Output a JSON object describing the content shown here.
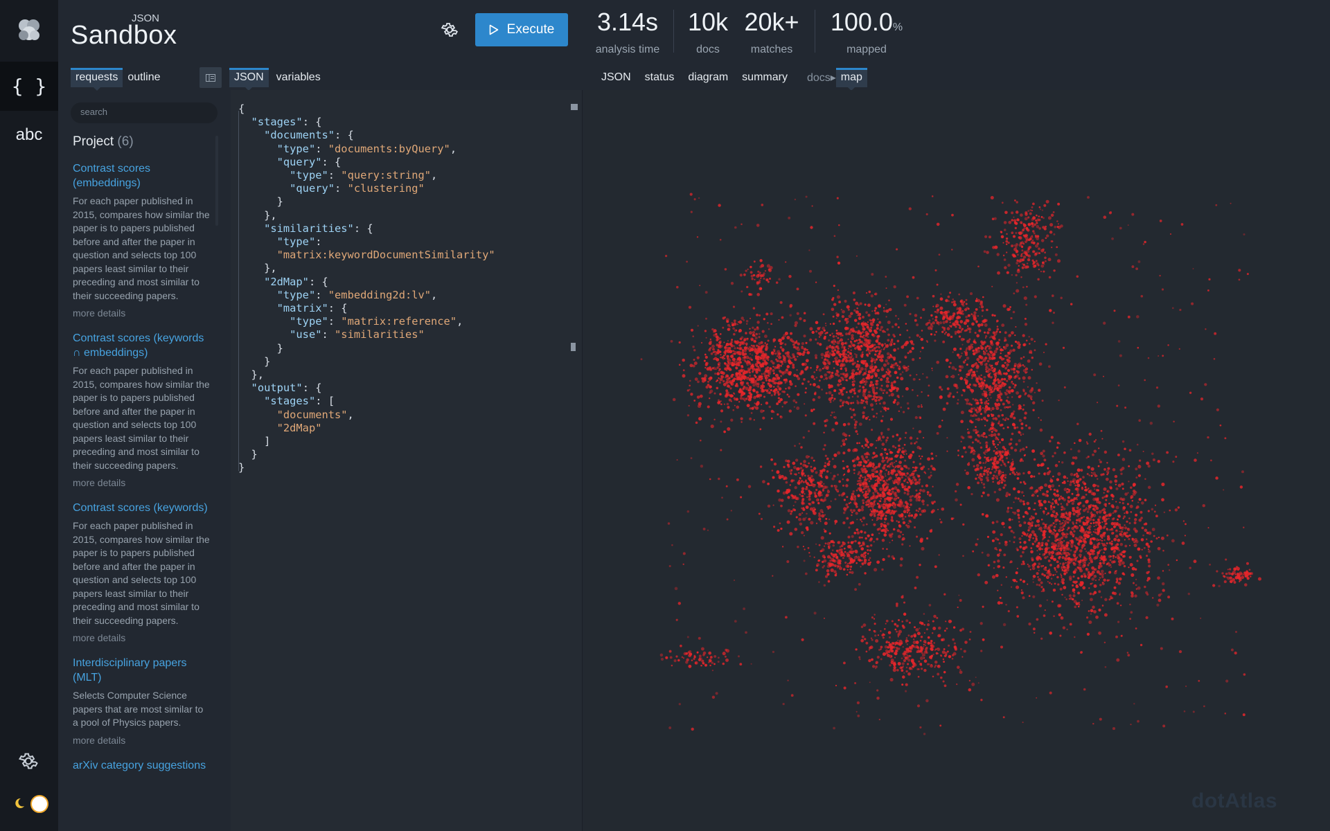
{
  "brand": {
    "sub": "JSON",
    "title": "Sandbox"
  },
  "toolbar": {
    "execute_label": "Execute"
  },
  "stats": [
    {
      "value": "3.14s",
      "unit": "",
      "label": "analysis time"
    },
    {
      "value": "10k",
      "unit": "",
      "label": "docs"
    },
    {
      "value": "20k+",
      "unit": "",
      "label": "matches"
    },
    {
      "value": "100.0",
      "unit": "%",
      "label": "mapped"
    }
  ],
  "rail": {
    "json_label": "{ }",
    "abc_label": "abc"
  },
  "left_tabs": [
    "requests",
    "outline"
  ],
  "editor_tabs": [
    "JSON",
    "variables"
  ],
  "result_tabs": [
    "JSON",
    "status",
    "diagram",
    "summary"
  ],
  "result_crumb": {
    "parent": "docs",
    "active": "map"
  },
  "search": {
    "placeholder": "search"
  },
  "project": {
    "title": "Project",
    "count": "(6)"
  },
  "requests": [
    {
      "title": "Contrast scores (embeddings)",
      "desc": "For each paper published in 2015, compares how similar the paper is to papers published before and after the paper in question and selects top 100 papers least similar to their preceding and most similar to their succeeding papers.",
      "more": "more details"
    },
    {
      "title": "Contrast scores (keywords ∩ embeddings)",
      "desc": "For each paper published in 2015, compares how similar the paper is to papers published before and after the paper in question and selects top 100 papers least similar to their preceding and most similar to their succeeding papers.",
      "more": "more details"
    },
    {
      "title": "Contrast scores (keywords)",
      "desc": "For each paper published in 2015, compares how similar the paper is to papers published before and after the paper in question and selects top 100 papers least similar to their preceding and most similar to their succeeding papers.",
      "more": "more details"
    },
    {
      "title": "Interdisciplinary papers (MLT)",
      "desc": "Selects Computer Science papers that are most similar to a pool of Physics papers.",
      "more": "more details"
    },
    {
      "title": "arXiv category suggestions",
      "desc": "",
      "more": ""
    }
  ],
  "code": [
    [
      [
        "p",
        "{"
      ]
    ],
    [
      [
        "p",
        "  "
      ],
      [
        "k",
        "\"stages\""
      ],
      [
        "p",
        ": {"
      ]
    ],
    [
      [
        "p",
        "    "
      ],
      [
        "k",
        "\"documents\""
      ],
      [
        "p",
        ": {"
      ]
    ],
    [
      [
        "p",
        "      "
      ],
      [
        "k",
        "\"type\""
      ],
      [
        "p",
        ": "
      ],
      [
        "s",
        "\"documents:byQuery\""
      ],
      [
        "p",
        ","
      ]
    ],
    [
      [
        "p",
        "      "
      ],
      [
        "k",
        "\"query\""
      ],
      [
        "p",
        ": {"
      ]
    ],
    [
      [
        "p",
        "        "
      ],
      [
        "k",
        "\"type\""
      ],
      [
        "p",
        ": "
      ],
      [
        "s",
        "\"query:string\""
      ],
      [
        "p",
        ","
      ]
    ],
    [
      [
        "p",
        "        "
      ],
      [
        "k",
        "\"query\""
      ],
      [
        "p",
        ": "
      ],
      [
        "s",
        "\"clustering\""
      ]
    ],
    [
      [
        "p",
        "      }"
      ]
    ],
    [
      [
        "p",
        "    },"
      ]
    ],
    [
      [
        "p",
        "    "
      ],
      [
        "k",
        "\"similarities\""
      ],
      [
        "p",
        ": {"
      ]
    ],
    [
      [
        "p",
        "      "
      ],
      [
        "k",
        "\"type\""
      ],
      [
        "p",
        ":"
      ]
    ],
    [
      [
        "p",
        "      "
      ],
      [
        "s",
        "\"matrix:keywordDocumentSimilarity\""
      ]
    ],
    [
      [
        "p",
        "    },"
      ]
    ],
    [
      [
        "p",
        "    "
      ],
      [
        "k",
        "\"2dMap\""
      ],
      [
        "p",
        ": {"
      ]
    ],
    [
      [
        "p",
        "      "
      ],
      [
        "k",
        "\"type\""
      ],
      [
        "p",
        ": "
      ],
      [
        "s",
        "\"embedding2d:lv\""
      ],
      [
        "p",
        ","
      ]
    ],
    [
      [
        "p",
        "      "
      ],
      [
        "k",
        "\"matrix\""
      ],
      [
        "p",
        ": {"
      ]
    ],
    [
      [
        "p",
        "        "
      ],
      [
        "k",
        "\"type\""
      ],
      [
        "p",
        ": "
      ],
      [
        "s",
        "\"matrix:reference\""
      ],
      [
        "p",
        ","
      ]
    ],
    [
      [
        "p",
        "        "
      ],
      [
        "k",
        "\"use\""
      ],
      [
        "p",
        ": "
      ],
      [
        "s",
        "\"similarities\""
      ]
    ],
    [
      [
        "p",
        "      }"
      ]
    ],
    [
      [
        "p",
        "    }"
      ]
    ],
    [
      [
        "p",
        "  },"
      ]
    ],
    [
      [
        "p",
        "  "
      ],
      [
        "k",
        "\"output\""
      ],
      [
        "p",
        ": {"
      ]
    ],
    [
      [
        "p",
        "    "
      ],
      [
        "k",
        "\"stages\""
      ],
      [
        "p",
        ": ["
      ]
    ],
    [
      [
        "p",
        "      "
      ],
      [
        "s",
        "\"documents\""
      ],
      [
        "p",
        ","
      ]
    ],
    [
      [
        "p",
        "      "
      ],
      [
        "s",
        "\"2dMap\""
      ]
    ],
    [
      [
        "p",
        "    ]"
      ]
    ],
    [
      [
        "p",
        "  }"
      ]
    ],
    [
      [
        "p",
        "}"
      ]
    ]
  ],
  "map": {
    "point_color": "#e8262b",
    "watermark": "dotAtlas"
  },
  "colors": {
    "accent": "#2d87cc",
    "background": "#222831",
    "link": "#47a3e0"
  }
}
